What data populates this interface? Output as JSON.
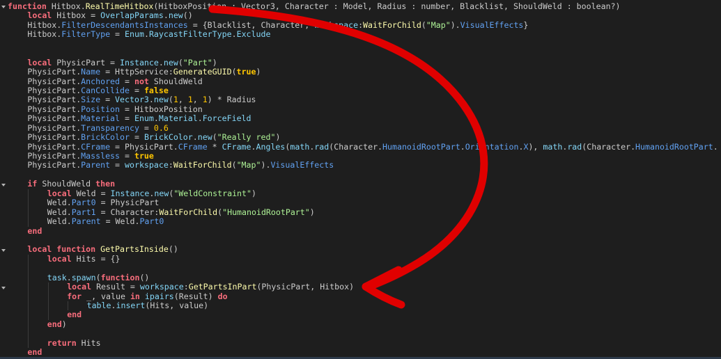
{
  "colors": {
    "background": "#1e1e1e",
    "keyword": "#f86d7c",
    "builtin": "#84d6f7",
    "member": "#61a1f1",
    "string": "#adf195",
    "number": "#ffc600",
    "function": "#fdfbac",
    "plain": "#cccccc",
    "annotation": "#e00000"
  },
  "editor": {
    "fold_lines": [
      0,
      19,
      26,
      30
    ],
    "lines": [
      {
        "indent": 0,
        "tokens": [
          [
            "kw",
            "function"
          ],
          [
            "op",
            " Hitbox."
          ],
          [
            "fn",
            "RealTimeHitbox"
          ],
          [
            "op",
            "(HitboxPosition : Vector3, Character : Model, Radius : number, Blacklist, ShouldWeld : boolean?)"
          ]
        ]
      },
      {
        "indent": 1,
        "tokens": [
          [
            "kw",
            "local"
          ],
          [
            "op",
            " Hitbox = "
          ],
          [
            "blt",
            "OverlapParams"
          ],
          [
            "op",
            "."
          ],
          [
            "blt",
            "new"
          ],
          [
            "op",
            "()"
          ]
        ]
      },
      {
        "indent": 1,
        "tokens": [
          [
            "op",
            "Hitbox."
          ],
          [
            "mem",
            "FilterDescendantsInstances"
          ],
          [
            "op",
            " = {Blacklist, Character, "
          ],
          [
            "blt",
            "workspace"
          ],
          [
            "op",
            ":"
          ],
          [
            "fn",
            "WaitForChild"
          ],
          [
            "op",
            "("
          ],
          [
            "str",
            "\"Map\""
          ],
          [
            "op",
            ")."
          ],
          [
            "mem",
            "VisualEffects"
          ],
          [
            "op",
            "}"
          ]
        ]
      },
      {
        "indent": 1,
        "tokens": [
          [
            "op",
            "Hitbox."
          ],
          [
            "mem",
            "FilterType"
          ],
          [
            "op",
            " = "
          ],
          [
            "blt",
            "Enum"
          ],
          [
            "op",
            "."
          ],
          [
            "blt",
            "RaycastFilterType"
          ],
          [
            "op",
            "."
          ],
          [
            "blt",
            "Exclude"
          ]
        ]
      },
      {
        "indent": 1,
        "tokens": []
      },
      {
        "indent": 1,
        "tokens": []
      },
      {
        "indent": 1,
        "tokens": [
          [
            "kw",
            "local"
          ],
          [
            "op",
            " PhysicPart = "
          ],
          [
            "blt",
            "Instance"
          ],
          [
            "op",
            "."
          ],
          [
            "blt",
            "new"
          ],
          [
            "op",
            "("
          ],
          [
            "str",
            "\"Part\""
          ],
          [
            "op",
            ")"
          ]
        ]
      },
      {
        "indent": 1,
        "tokens": [
          [
            "op",
            "PhysicPart."
          ],
          [
            "mem",
            "Name"
          ],
          [
            "op",
            " = HttpService:"
          ],
          [
            "fn",
            "GenerateGUID"
          ],
          [
            "op",
            "("
          ],
          [
            "bool",
            "true"
          ],
          [
            "op",
            ")"
          ]
        ]
      },
      {
        "indent": 1,
        "tokens": [
          [
            "op",
            "PhysicPart."
          ],
          [
            "mem",
            "Anchored"
          ],
          [
            "op",
            " = "
          ],
          [
            "kw",
            "not"
          ],
          [
            "op",
            " ShouldWeld"
          ]
        ]
      },
      {
        "indent": 1,
        "tokens": [
          [
            "op",
            "PhysicPart."
          ],
          [
            "mem",
            "CanCollide"
          ],
          [
            "op",
            " = "
          ],
          [
            "bool",
            "false"
          ]
        ]
      },
      {
        "indent": 1,
        "tokens": [
          [
            "op",
            "PhysicPart."
          ],
          [
            "mem",
            "Size"
          ],
          [
            "op",
            " = "
          ],
          [
            "blt",
            "Vector3"
          ],
          [
            "op",
            "."
          ],
          [
            "blt",
            "new"
          ],
          [
            "op",
            "("
          ],
          [
            "num",
            "1"
          ],
          [
            "op",
            ", "
          ],
          [
            "num",
            "1"
          ],
          [
            "op",
            ", "
          ],
          [
            "num",
            "1"
          ],
          [
            "op",
            ") * Radius"
          ]
        ]
      },
      {
        "indent": 1,
        "tokens": [
          [
            "op",
            "PhysicPart."
          ],
          [
            "mem",
            "Position"
          ],
          [
            "op",
            " = HitboxPosition"
          ]
        ]
      },
      {
        "indent": 1,
        "tokens": [
          [
            "op",
            "PhysicPart."
          ],
          [
            "mem",
            "Material"
          ],
          [
            "op",
            " = "
          ],
          [
            "blt",
            "Enum"
          ],
          [
            "op",
            "."
          ],
          [
            "blt",
            "Material"
          ],
          [
            "op",
            "."
          ],
          [
            "blt",
            "ForceField"
          ]
        ]
      },
      {
        "indent": 1,
        "tokens": [
          [
            "op",
            "PhysicPart."
          ],
          [
            "mem",
            "Transparency"
          ],
          [
            "op",
            " = "
          ],
          [
            "num",
            "0.6"
          ]
        ]
      },
      {
        "indent": 1,
        "tokens": [
          [
            "op",
            "PhysicPart."
          ],
          [
            "mem",
            "BrickColor"
          ],
          [
            "op",
            " = "
          ],
          [
            "blt",
            "BrickColor"
          ],
          [
            "op",
            "."
          ],
          [
            "blt",
            "new"
          ],
          [
            "op",
            "("
          ],
          [
            "str",
            "\"Really red\""
          ],
          [
            "op",
            ")"
          ]
        ]
      },
      {
        "indent": 1,
        "tokens": [
          [
            "op",
            "PhysicPart."
          ],
          [
            "mem",
            "CFrame"
          ],
          [
            "op",
            " = PhysicPart."
          ],
          [
            "mem",
            "CFrame"
          ],
          [
            "op",
            " * "
          ],
          [
            "blt",
            "CFrame"
          ],
          [
            "op",
            "."
          ],
          [
            "blt",
            "Angles"
          ],
          [
            "op",
            "("
          ],
          [
            "blt",
            "math"
          ],
          [
            "op",
            "."
          ],
          [
            "blt",
            "rad"
          ],
          [
            "op",
            "(Character."
          ],
          [
            "mem",
            "HumanoidRootPart"
          ],
          [
            "op",
            "."
          ],
          [
            "mem",
            "Orientation"
          ],
          [
            "op",
            "."
          ],
          [
            "mem",
            "X"
          ],
          [
            "op",
            "), "
          ],
          [
            "blt",
            "math"
          ],
          [
            "op",
            "."
          ],
          [
            "blt",
            "rad"
          ],
          [
            "op",
            "(Character."
          ],
          [
            "mem",
            "HumanoidRootPart"
          ],
          [
            "op",
            "."
          ]
        ]
      },
      {
        "indent": 1,
        "tokens": [
          [
            "op",
            "PhysicPart."
          ],
          [
            "mem",
            "Massless"
          ],
          [
            "op",
            " = "
          ],
          [
            "bool",
            "true"
          ]
        ]
      },
      {
        "indent": 1,
        "tokens": [
          [
            "op",
            "PhysicPart."
          ],
          [
            "mem",
            "Parent"
          ],
          [
            "op",
            " = "
          ],
          [
            "blt",
            "workspace"
          ],
          [
            "op",
            ":"
          ],
          [
            "fn",
            "WaitForChild"
          ],
          [
            "op",
            "("
          ],
          [
            "str",
            "\"Map\""
          ],
          [
            "op",
            ")."
          ],
          [
            "mem",
            "VisualEffects"
          ]
        ]
      },
      {
        "indent": 1,
        "tokens": []
      },
      {
        "indent": 1,
        "tokens": [
          [
            "kw",
            "if"
          ],
          [
            "op",
            " ShouldWeld "
          ],
          [
            "kw",
            "then"
          ]
        ]
      },
      {
        "indent": 2,
        "tokens": [
          [
            "kw",
            "local"
          ],
          [
            "op",
            " Weld = "
          ],
          [
            "blt",
            "Instance"
          ],
          [
            "op",
            "."
          ],
          [
            "blt",
            "new"
          ],
          [
            "op",
            "("
          ],
          [
            "str",
            "\"WeldConstraint\""
          ],
          [
            "op",
            ")"
          ]
        ]
      },
      {
        "indent": 2,
        "tokens": [
          [
            "op",
            "Weld."
          ],
          [
            "mem",
            "Part0"
          ],
          [
            "op",
            " = PhysicPart"
          ]
        ]
      },
      {
        "indent": 2,
        "tokens": [
          [
            "op",
            "Weld."
          ],
          [
            "mem",
            "Part1"
          ],
          [
            "op",
            " = Character:"
          ],
          [
            "fn",
            "WaitForChild"
          ],
          [
            "op",
            "("
          ],
          [
            "str",
            "\"HumanoidRootPart\""
          ],
          [
            "op",
            ")"
          ]
        ]
      },
      {
        "indent": 2,
        "tokens": [
          [
            "op",
            "Weld."
          ],
          [
            "mem",
            "Parent"
          ],
          [
            "op",
            " = Weld."
          ],
          [
            "mem",
            "Part0"
          ]
        ]
      },
      {
        "indent": 1,
        "tokens": [
          [
            "kw",
            "end"
          ]
        ]
      },
      {
        "indent": 1,
        "tokens": []
      },
      {
        "indent": 1,
        "tokens": [
          [
            "kw",
            "local"
          ],
          [
            "op",
            " "
          ],
          [
            "kw",
            "function"
          ],
          [
            "op",
            " "
          ],
          [
            "fn",
            "GetPartsInside"
          ],
          [
            "op",
            "()"
          ]
        ]
      },
      {
        "indent": 2,
        "tokens": [
          [
            "kw",
            "local"
          ],
          [
            "op",
            " Hits = {}"
          ]
        ]
      },
      {
        "indent": 2,
        "tokens": []
      },
      {
        "indent": 2,
        "tokens": [
          [
            "blt",
            "task"
          ],
          [
            "op",
            "."
          ],
          [
            "blt",
            "spawn"
          ],
          [
            "op",
            "("
          ],
          [
            "kw",
            "function"
          ],
          [
            "op",
            "()"
          ]
        ]
      },
      {
        "indent": 3,
        "tokens": [
          [
            "kw",
            "local"
          ],
          [
            "op",
            " Result = "
          ],
          [
            "blt",
            "workspace"
          ],
          [
            "op",
            ":"
          ],
          [
            "fn",
            "GetPartsInPart"
          ],
          [
            "op",
            "(PhysicPart, Hitbox)"
          ]
        ]
      },
      {
        "indent": 3,
        "tokens": [
          [
            "kw",
            "for"
          ],
          [
            "op",
            " _, value "
          ],
          [
            "kw",
            "in"
          ],
          [
            "op",
            " "
          ],
          [
            "blt",
            "ipairs"
          ],
          [
            "op",
            "(Result) "
          ],
          [
            "kw",
            "do"
          ]
        ]
      },
      {
        "indent": 4,
        "tokens": [
          [
            "blt",
            "table"
          ],
          [
            "op",
            "."
          ],
          [
            "blt",
            "insert"
          ],
          [
            "op",
            "(Hits, value)"
          ]
        ]
      },
      {
        "indent": 3,
        "tokens": [
          [
            "kw",
            "end"
          ]
        ]
      },
      {
        "indent": 2,
        "tokens": [
          [
            "kw",
            "end"
          ],
          [
            "op",
            ")"
          ]
        ]
      },
      {
        "indent": 2,
        "tokens": []
      },
      {
        "indent": 2,
        "tokens": [
          [
            "kw",
            "return"
          ],
          [
            "op",
            " Hits"
          ]
        ]
      },
      {
        "indent": 1,
        "tokens": [
          [
            "kw",
            "end"
          ]
        ]
      }
    ]
  }
}
